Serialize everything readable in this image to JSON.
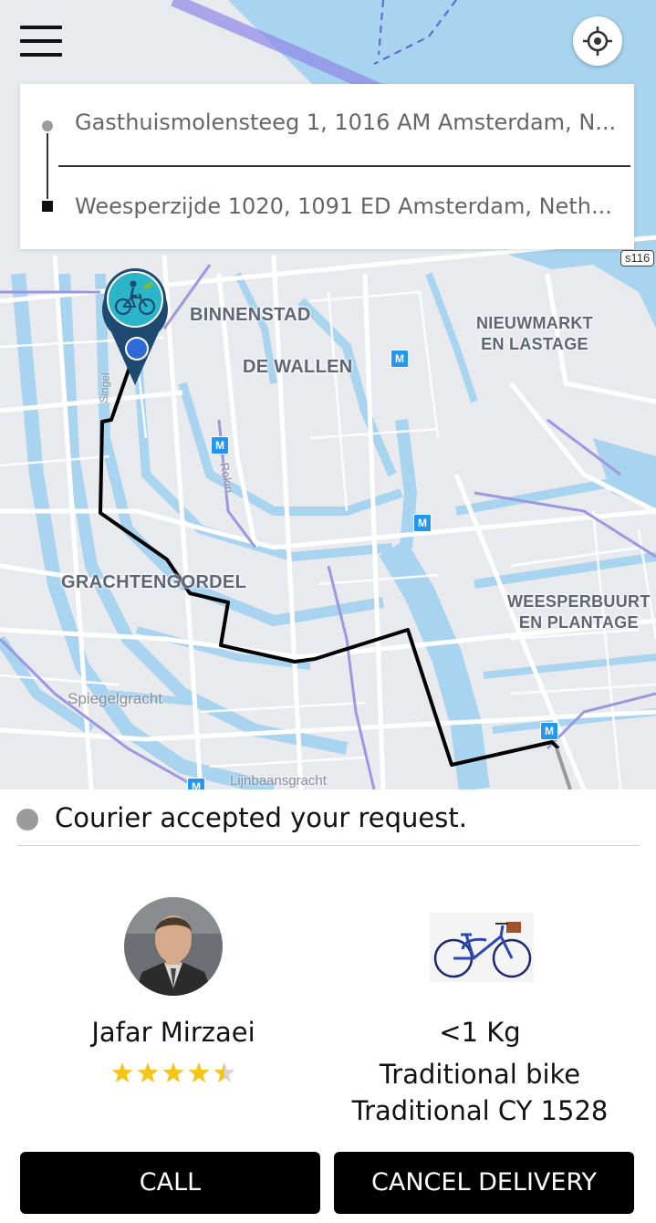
{
  "map": {
    "labels": {
      "binnenstad": "BINNENSTAD",
      "de_wallen": "DE WALLEN",
      "nieuwmarkt_line1": "NIEUWMARKT",
      "nieuwmarkt_line2": "EN LASTAGE",
      "grachtengordel": "GRACHTENGORDEL",
      "weesperbuurt_line1": "WEESPERBUURT",
      "weesperbuurt_line2": "EN PLANTAGE",
      "spiegelgracht": "Spiegelgracht",
      "lijnbaansgracht": "Lijnbaansgracht",
      "rokin": "Rokin",
      "singel": "Singel",
      "road_shield": "s116",
      "metro_symbol": "M"
    },
    "colors": {
      "water": "#a8d4ef",
      "land": "#e9eaee",
      "road": "#ffffff",
      "route": "#000000",
      "tram": "#9c98e0",
      "pin": "#2ab5c9",
      "pin_dark": "#1e4a72"
    }
  },
  "header": {
    "menu_icon": "hamburger-menu-icon",
    "locate_icon": "my-location-icon"
  },
  "addresses": {
    "pickup": "Gasthuismolensteeg 1, 1016 AM Amsterdam, N...",
    "dropoff": "Weesperzijde 1020, 1091 ED Amsterdam, Neth..."
  },
  "status": {
    "text": "Courier accepted your request."
  },
  "courier": {
    "name": "Jafar Mirzaei",
    "rating": 4.5,
    "rating_max": 5
  },
  "vehicle": {
    "weight": "<1 Kg",
    "type": "Traditional bike",
    "plate": "Traditional CY 1528"
  },
  "actions": {
    "call_label": "CALL",
    "cancel_label": "CANCEL DELIVERY"
  }
}
